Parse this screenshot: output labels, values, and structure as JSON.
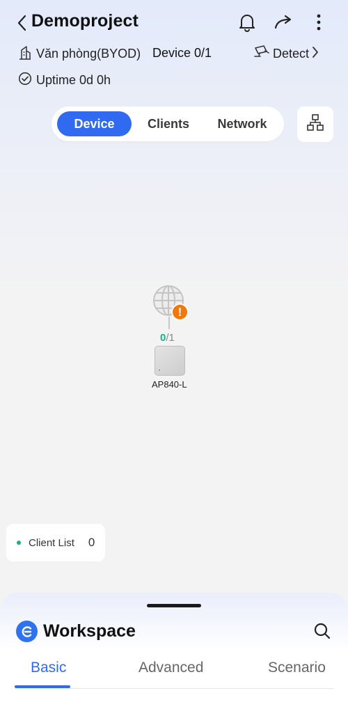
{
  "header": {
    "title": "Demoproject",
    "site_name": "Văn phòng(BYOD)",
    "device_count": "Device 0/1",
    "detect_label": "Detect",
    "uptime": "Uptime 0d 0h"
  },
  "tabs": [
    {
      "label": "Device",
      "active": true
    },
    {
      "label": "Clients",
      "active": false
    },
    {
      "label": "Network",
      "active": false
    }
  ],
  "topology": {
    "online": "0",
    "total": "/1",
    "device_name": "AP840-L",
    "warning_symbol": "!"
  },
  "client_list": {
    "label": "Client List",
    "count": "0"
  },
  "workspace": {
    "title": "Workspace",
    "tabs": [
      {
        "label": "Basic",
        "active": true
      },
      {
        "label": "Advanced",
        "active": false
      },
      {
        "label": "Scenario",
        "active": false
      }
    ]
  },
  "colors": {
    "accent": "#2f6af0",
    "online": "#18b08a",
    "warning": "#f0790f"
  },
  "icons": [
    "back-icon",
    "bell-icon",
    "share-icon",
    "more-icon",
    "building-icon",
    "detect-icon",
    "chevron-right-icon",
    "check-circle-icon",
    "topology-icon",
    "globe-icon",
    "warning-icon",
    "workspace-logo-icon",
    "search-icon"
  ]
}
